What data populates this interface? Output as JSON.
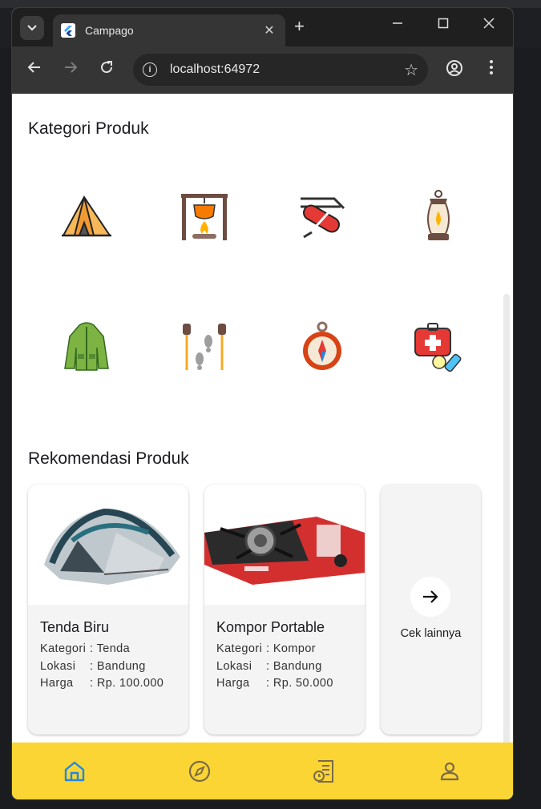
{
  "browser": {
    "tab_title": "Campago",
    "url": "localhost:64972",
    "new_tab_symbol": "+"
  },
  "page": {
    "categories_heading": "Kategori Produk",
    "categories": [
      {
        "icon": "tent-icon"
      },
      {
        "icon": "campfire-cooking-icon"
      },
      {
        "icon": "multitool-knife-icon"
      },
      {
        "icon": "lantern-icon"
      },
      {
        "icon": "jacket-icon"
      },
      {
        "icon": "trekking-poles-icon"
      },
      {
        "icon": "compass-icon"
      },
      {
        "icon": "first-aid-kit-icon"
      }
    ],
    "recommend_heading": "Rekomendasi Produk",
    "products": [
      {
        "name": "Tenda Biru",
        "category_label": "Kategori",
        "category": ": Tenda",
        "location_label": "Lokasi",
        "location": ": Bandung",
        "price_label": "Harga",
        "price": ": Rp. 100.000"
      },
      {
        "name": "Kompor Portable",
        "category_label": "Kategori",
        "category": ": Kompor",
        "location_label": "Lokasi",
        "location": ": Bandung",
        "price_label": "Harga",
        "price": ": Rp. 50.000"
      }
    ],
    "more_label": "Cek lainnya"
  },
  "bottom_nav": {
    "items": [
      {
        "icon": "home-icon",
        "active": true
      },
      {
        "icon": "explore-compass-icon",
        "active": false
      },
      {
        "icon": "orders-history-icon",
        "active": false
      },
      {
        "icon": "profile-icon",
        "active": false
      }
    ],
    "active_color": "#1e88e5",
    "background": "#fbd534"
  },
  "colors": {
    "nav_icon": "#7a6a4a"
  }
}
